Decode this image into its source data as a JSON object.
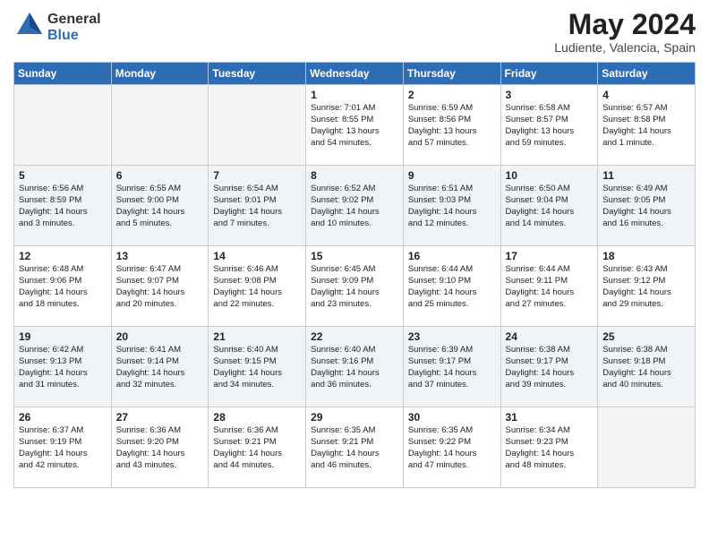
{
  "logo": {
    "text_general": "General",
    "text_blue": "Blue"
  },
  "header": {
    "month_title": "May 2024",
    "location": "Ludiente, Valencia, Spain"
  },
  "days_of_week": [
    "Sunday",
    "Monday",
    "Tuesday",
    "Wednesday",
    "Thursday",
    "Friday",
    "Saturday"
  ],
  "weeks": [
    [
      {
        "day": "",
        "info": ""
      },
      {
        "day": "",
        "info": ""
      },
      {
        "day": "",
        "info": ""
      },
      {
        "day": "1",
        "info": "Sunrise: 7:01 AM\nSunset: 8:55 PM\nDaylight: 13 hours\nand 54 minutes."
      },
      {
        "day": "2",
        "info": "Sunrise: 6:59 AM\nSunset: 8:56 PM\nDaylight: 13 hours\nand 57 minutes."
      },
      {
        "day": "3",
        "info": "Sunrise: 6:58 AM\nSunset: 8:57 PM\nDaylight: 13 hours\nand 59 minutes."
      },
      {
        "day": "4",
        "info": "Sunrise: 6:57 AM\nSunset: 8:58 PM\nDaylight: 14 hours\nand 1 minute."
      }
    ],
    [
      {
        "day": "5",
        "info": "Sunrise: 6:56 AM\nSunset: 8:59 PM\nDaylight: 14 hours\nand 3 minutes."
      },
      {
        "day": "6",
        "info": "Sunrise: 6:55 AM\nSunset: 9:00 PM\nDaylight: 14 hours\nand 5 minutes."
      },
      {
        "day": "7",
        "info": "Sunrise: 6:54 AM\nSunset: 9:01 PM\nDaylight: 14 hours\nand 7 minutes."
      },
      {
        "day": "8",
        "info": "Sunrise: 6:52 AM\nSunset: 9:02 PM\nDaylight: 14 hours\nand 10 minutes."
      },
      {
        "day": "9",
        "info": "Sunrise: 6:51 AM\nSunset: 9:03 PM\nDaylight: 14 hours\nand 12 minutes."
      },
      {
        "day": "10",
        "info": "Sunrise: 6:50 AM\nSunset: 9:04 PM\nDaylight: 14 hours\nand 14 minutes."
      },
      {
        "day": "11",
        "info": "Sunrise: 6:49 AM\nSunset: 9:05 PM\nDaylight: 14 hours\nand 16 minutes."
      }
    ],
    [
      {
        "day": "12",
        "info": "Sunrise: 6:48 AM\nSunset: 9:06 PM\nDaylight: 14 hours\nand 18 minutes."
      },
      {
        "day": "13",
        "info": "Sunrise: 6:47 AM\nSunset: 9:07 PM\nDaylight: 14 hours\nand 20 minutes."
      },
      {
        "day": "14",
        "info": "Sunrise: 6:46 AM\nSunset: 9:08 PM\nDaylight: 14 hours\nand 22 minutes."
      },
      {
        "day": "15",
        "info": "Sunrise: 6:45 AM\nSunset: 9:09 PM\nDaylight: 14 hours\nand 23 minutes."
      },
      {
        "day": "16",
        "info": "Sunrise: 6:44 AM\nSunset: 9:10 PM\nDaylight: 14 hours\nand 25 minutes."
      },
      {
        "day": "17",
        "info": "Sunrise: 6:44 AM\nSunset: 9:11 PM\nDaylight: 14 hours\nand 27 minutes."
      },
      {
        "day": "18",
        "info": "Sunrise: 6:43 AM\nSunset: 9:12 PM\nDaylight: 14 hours\nand 29 minutes."
      }
    ],
    [
      {
        "day": "19",
        "info": "Sunrise: 6:42 AM\nSunset: 9:13 PM\nDaylight: 14 hours\nand 31 minutes."
      },
      {
        "day": "20",
        "info": "Sunrise: 6:41 AM\nSunset: 9:14 PM\nDaylight: 14 hours\nand 32 minutes."
      },
      {
        "day": "21",
        "info": "Sunrise: 6:40 AM\nSunset: 9:15 PM\nDaylight: 14 hours\nand 34 minutes."
      },
      {
        "day": "22",
        "info": "Sunrise: 6:40 AM\nSunset: 9:16 PM\nDaylight: 14 hours\nand 36 minutes."
      },
      {
        "day": "23",
        "info": "Sunrise: 6:39 AM\nSunset: 9:17 PM\nDaylight: 14 hours\nand 37 minutes."
      },
      {
        "day": "24",
        "info": "Sunrise: 6:38 AM\nSunset: 9:17 PM\nDaylight: 14 hours\nand 39 minutes."
      },
      {
        "day": "25",
        "info": "Sunrise: 6:38 AM\nSunset: 9:18 PM\nDaylight: 14 hours\nand 40 minutes."
      }
    ],
    [
      {
        "day": "26",
        "info": "Sunrise: 6:37 AM\nSunset: 9:19 PM\nDaylight: 14 hours\nand 42 minutes."
      },
      {
        "day": "27",
        "info": "Sunrise: 6:36 AM\nSunset: 9:20 PM\nDaylight: 14 hours\nand 43 minutes."
      },
      {
        "day": "28",
        "info": "Sunrise: 6:36 AM\nSunset: 9:21 PM\nDaylight: 14 hours\nand 44 minutes."
      },
      {
        "day": "29",
        "info": "Sunrise: 6:35 AM\nSunset: 9:21 PM\nDaylight: 14 hours\nand 46 minutes."
      },
      {
        "day": "30",
        "info": "Sunrise: 6:35 AM\nSunset: 9:22 PM\nDaylight: 14 hours\nand 47 minutes."
      },
      {
        "day": "31",
        "info": "Sunrise: 6:34 AM\nSunset: 9:23 PM\nDaylight: 14 hours\nand 48 minutes."
      },
      {
        "day": "",
        "info": ""
      }
    ]
  ]
}
